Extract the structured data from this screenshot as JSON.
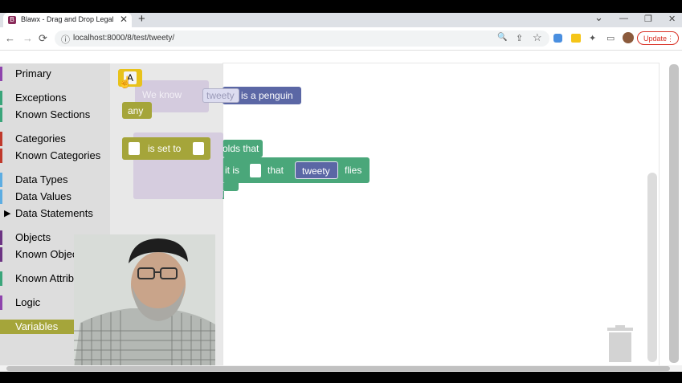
{
  "browser": {
    "tab_title": "Blawx - Drag and Drop Legal AI",
    "tab_favicon_letter": "B",
    "close_glyph": "✕",
    "new_tab_glyph": "+",
    "url": "localhost:8000/8/test/tweety/",
    "update_label": "Update",
    "back_glyph": "←",
    "forward_glyph": "→",
    "reload_glyph": "⟳",
    "info_glyph": "ⓘ",
    "zoom_glyph": "🔍",
    "share_glyph": "⇪",
    "star_glyph": "☆",
    "extensions_glyph": "✦",
    "sidepanel_glyph": "▭",
    "menu_glyph": "⋮",
    "minimize_glyph": "—",
    "restore_glyph": "❐",
    "chevron_glyph": "⌄"
  },
  "toolbox": {
    "categories": [
      {
        "label": "Primary",
        "color": "#8e44ad"
      },
      {
        "label": "Exceptions",
        "color": "#3aa57a"
      },
      {
        "label": "Known Sections",
        "color": "#3aa57a"
      },
      {
        "label": "Categories",
        "color": "#c0392b"
      },
      {
        "label": "Known Categories",
        "color": "#c0392b"
      },
      {
        "label": "Data Types",
        "color": "#5dade2"
      },
      {
        "label": "Data Values",
        "color": "#5dade2"
      },
      {
        "label": "Data Statements",
        "color": "#5dade2"
      },
      {
        "label": "Objects",
        "color": "#6c3483"
      },
      {
        "label": "Known Objects",
        "color": "#6c3483"
      },
      {
        "label": "Known Attributes",
        "color": "#3aa57a"
      },
      {
        "label": "Logic",
        "color": "#8e44ad"
      },
      {
        "label": "Variables",
        "color": "#a5a53a"
      }
    ],
    "selected_arrow": "▶"
  },
  "flyout": {
    "var_a_label": "A",
    "any_label": "any",
    "is_set_to_label": "is set to"
  },
  "workspace": {
    "we_know_label": "We know",
    "tweety_label": "tweety",
    "is_penguin_label": "is a penguin",
    "holds_that_label": "olds that",
    "it_is_label": "it is",
    "that_label": "that",
    "flies_label": "flies"
  },
  "colors": {
    "variable_block": "#a5a53a",
    "penguin_block": "#5b67a5",
    "flies_block": "#4aa77a",
    "holds_block": "#4aa77a",
    "tweety_object": "#5b67a5",
    "ghost_block": "#c9bfd6"
  },
  "icons": [
    "trash-icon",
    "cursor-hand-icon",
    "person-video"
  ]
}
